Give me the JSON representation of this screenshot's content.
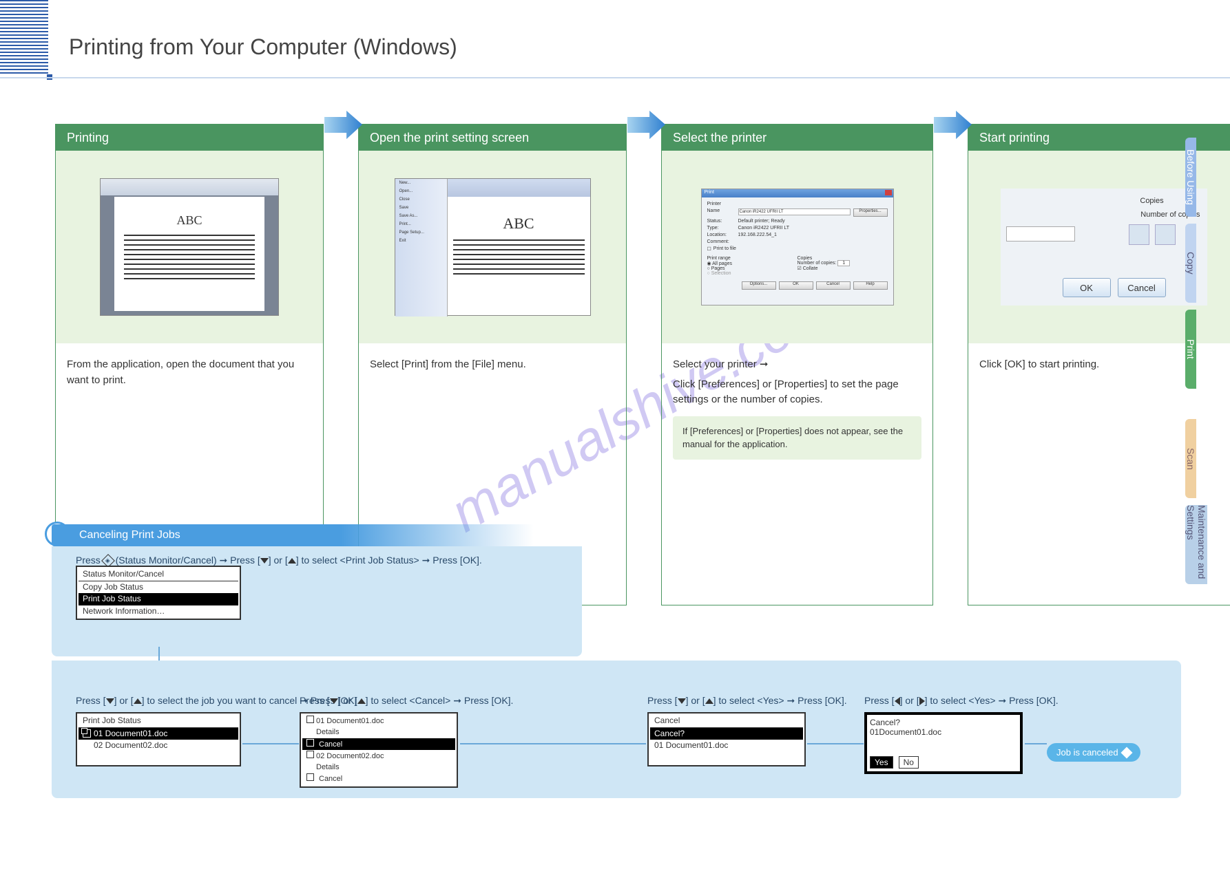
{
  "page": {
    "title": "Printing from Your Computer (Windows)"
  },
  "steps": [
    {
      "header": "Printing",
      "body": "From the application, open the document that you want to print.",
      "img_abc": "ABC"
    },
    {
      "header": "Open the print setting screen",
      "body_line1": "Select [Print] from the [File] menu.",
      "img_abc": "ABC",
      "menu": [
        "New...",
        "Open...",
        "Close",
        "Save",
        "Save As...",
        "Print...",
        "Page Setup...",
        "Exit"
      ]
    },
    {
      "header": "Select the printer",
      "body_line1": "Select your printer ",
      "body_line2": "Click [Preferences] or [Properties] to set the page settings or the number of copies.",
      "note": "If [Preferences] or [Properties] does not appear, see the manual for the application.",
      "dialog": {
        "title": "Print",
        "labels": {
          "name": "Name",
          "status": "Status:",
          "type": "Type:",
          "location": "Location:",
          "comment": "Comment:"
        },
        "printer_name": "Canon iR2422 UFRII LT",
        "status_val": "Default printer; Ready",
        "type_val": "Canon iR2422 UFRII LT",
        "location_val": "192.168.222.54_1",
        "properties_btn": "Properties...",
        "print_to_file": "Print to file",
        "range_title": "Print range",
        "all_pages": "All pages",
        "pages": "Pages",
        "selection": "Selection",
        "copies_title": "Copies",
        "num_copies": "Number of copies:",
        "collate": "Collate",
        "options": "Options...",
        "ok": "OK",
        "cancel": "Cancel",
        "help": "Help"
      }
    },
    {
      "header": "Start printing",
      "body": "Click [OK] to start printing.",
      "copies_group": "Copies",
      "num_copies": "Number of copies",
      "ok": "OK",
      "cancel": "Cancel"
    }
  ],
  "tip": {
    "title": "Canceling Print Jobs",
    "line1_a": "Press ",
    "line1_b": " (Status Monitor/Cancel) ",
    "line1_c": " Press [",
    "line1_d": "] or [",
    "line1_e": "] to select <Print Job Status> ",
    "line1_f": " Press [OK].",
    "lcd1": {
      "r1": "Status Monitor/Cancel",
      "r2": "Copy Job Status",
      "r3": "Print Job Status",
      "r4": "Network Information…"
    },
    "step2_a": "Press [",
    "step2_b": "] or [",
    "step2_c": "] to select the job you want to cancel ",
    "step2_d": " Press [OK].",
    "lcd2": {
      "head": "Print Job Status",
      "r1": "01 Document01.doc",
      "r2": "02 Document02.doc"
    },
    "step3_a": "Press [",
    "step3_b": "] or [",
    "step3_c": "] to select <Cancel> ",
    "step3_d": " Press [OK].",
    "lcd3": {
      "r1": "01 Document01.doc",
      "r2": "Details",
      "r3": "Cancel",
      "r4": "02 Document02.doc",
      "r5": "Details",
      "r6": "Cancel"
    },
    "step4_a": "Press [",
    "step4_b": "] or [",
    "step4_c": "] to select <Yes> ",
    "step4_d": " Press [OK].",
    "lcd4": {
      "r1": "Cancel",
      "r2": "Cancel?",
      "r3": "01 Document01.doc"
    },
    "step5_a": "Press [",
    "step5_b": "] or [",
    "step5_c": "] to select <Yes> ",
    "step5_d": " Press [OK].",
    "lcd5": {
      "r1": "Cancel?",
      "r2": "01Document01.doc",
      "yes": "Yes",
      "no": "No"
    },
    "start_hint": "Job is canceled "
  },
  "right_tabs": [
    "Before Using",
    "Copy",
    "Print",
    "",
    "Scan",
    "Maintenance and Settings"
  ],
  "watermark": "manualshive.com"
}
